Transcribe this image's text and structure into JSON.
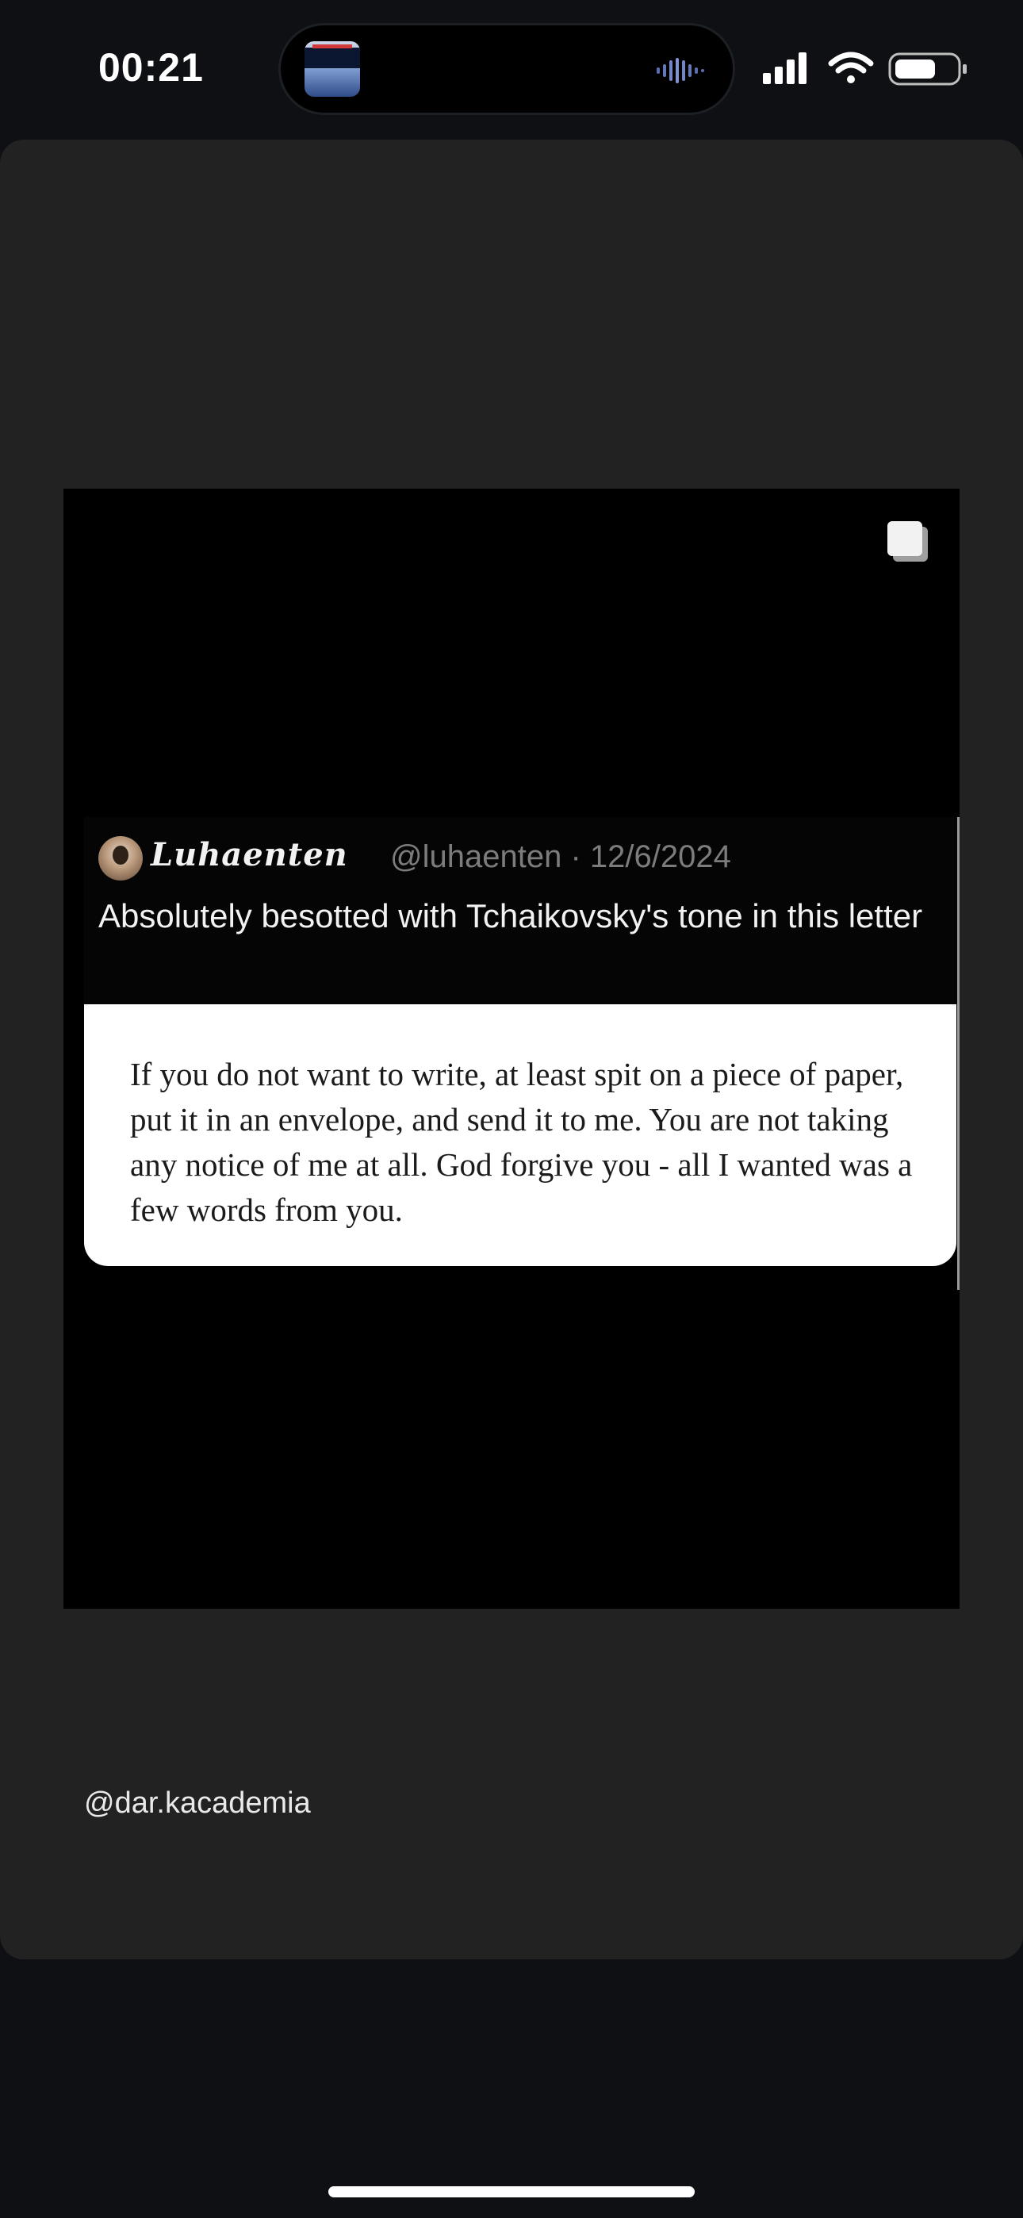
{
  "status_bar": {
    "time": "00:21"
  },
  "dynamic_island": {
    "artwork_icon": "album-art-icon",
    "activity_icon": "waveform-icon"
  },
  "status_icons": [
    "cellular-signal-icon",
    "wifi-icon",
    "battery-icon"
  ],
  "post": {
    "carousel_icon": "multiple-images-icon",
    "tweet": {
      "display_name": "Luhaenten",
      "handle_and_date": "@luhaenten · 12/6/2024",
      "text": "Absolutely besotted with Tchaikovsky's tone in this letter",
      "quote": "If you do not want to write, at least spit on a piece of paper, put it in an envelope, and send it to me. You are not taking any notice of me at all. God forgive you - all I wanted was a few words from you."
    },
    "caption": "@dar.kacademia"
  },
  "colors": {
    "background": "#0e1014",
    "card": "#222222",
    "media": "#000000",
    "letter_bg": "#ffffff",
    "handle_gray": "#7c7c7c"
  }
}
